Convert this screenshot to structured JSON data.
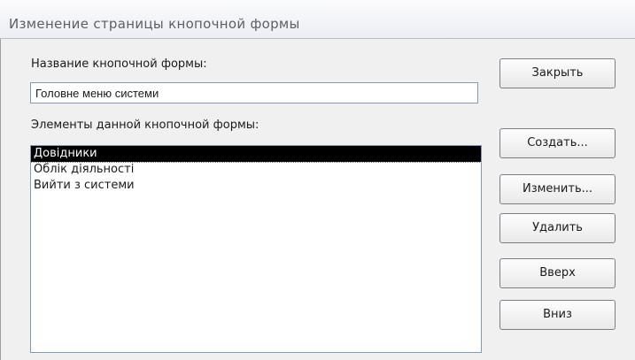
{
  "window": {
    "title": "Изменение страницы кнопочной формы"
  },
  "switchboard_name": {
    "label": "Название кнопочной формы:",
    "value": "Головне меню системи"
  },
  "items": {
    "label": "Элементы данной кнопочной формы:",
    "list": [
      {
        "label": "Довідники",
        "selected": true
      },
      {
        "label": "Облік діяльності",
        "selected": false
      },
      {
        "label": "Вийти з системи",
        "selected": false
      }
    ]
  },
  "buttons": {
    "close": "Закрыть",
    "create": "Создать...",
    "edit": "Изменить...",
    "delete": "Удалить",
    "up": "Вверх",
    "down": "Вниз"
  },
  "colors": {
    "selection_background": "#000000",
    "selection_text": "#ffffff",
    "field_border": "#7f9db9"
  }
}
